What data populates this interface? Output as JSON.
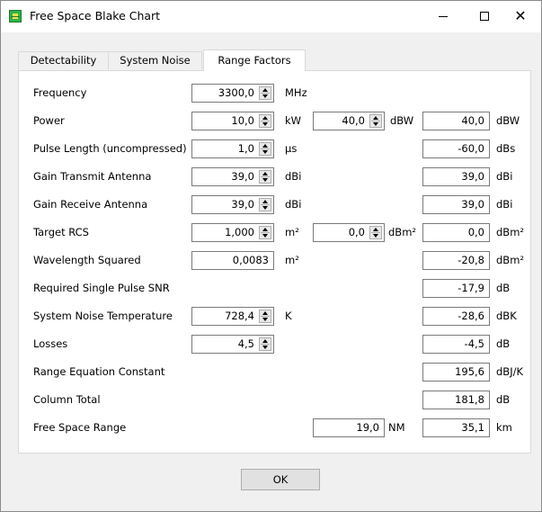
{
  "window": {
    "title": "Free Space Blake Chart"
  },
  "tabs": [
    {
      "label": "Detectability"
    },
    {
      "label": "System Noise"
    },
    {
      "label": "Range Factors"
    }
  ],
  "rows": [
    {
      "label": "Frequency",
      "input": "3300,0",
      "input_unit": "MHz"
    },
    {
      "label": "Power",
      "input": "10,0",
      "input_unit": "kW",
      "mid": "40,0",
      "mid_unit": "dBW",
      "result": "40,0",
      "result_unit": "dBW"
    },
    {
      "label": "Pulse Length (uncompressed)",
      "input": "1,0",
      "input_unit": "µs",
      "result": "-60,0",
      "result_unit": "dBs"
    },
    {
      "label": "Gain Transmit Antenna",
      "input": "39,0",
      "input_unit": "dBi",
      "result": "39,0",
      "result_unit": "dBi"
    },
    {
      "label": "Gain Receive Antenna",
      "input": "39,0",
      "input_unit": "dBi",
      "result": "39,0",
      "result_unit": "dBi"
    },
    {
      "label": "Target RCS",
      "input": "1,000",
      "input_unit": "m²",
      "mid": "0,0",
      "mid_unit": "dBm²",
      "result": "0,0",
      "result_unit": "dBm²"
    },
    {
      "label": "Wavelength Squared",
      "input": "0,0083",
      "input_unit": "m²",
      "result": "-20,8",
      "result_unit": "dBm²"
    },
    {
      "label": "Required Single Pulse SNR",
      "result": "-17,9",
      "result_unit": "dB"
    },
    {
      "label": "System Noise Temperature",
      "input": "728,4",
      "input_unit": "K",
      "result": "-28,6",
      "result_unit": "dBK"
    },
    {
      "label": "Losses",
      "input": "4,5",
      "result": "-4,5",
      "result_unit": "dB"
    },
    {
      "label": "Range Equation Constant",
      "result": "195,6",
      "result_unit": "dBJ/K"
    },
    {
      "label": "Column Total",
      "result": "181,8",
      "result_unit": "dB"
    },
    {
      "label": "Free Space Range",
      "mid": "19,0",
      "mid_unit": "NM",
      "result": "35,1",
      "result_unit": "km"
    }
  ],
  "buttons": {
    "ok": "OK"
  }
}
